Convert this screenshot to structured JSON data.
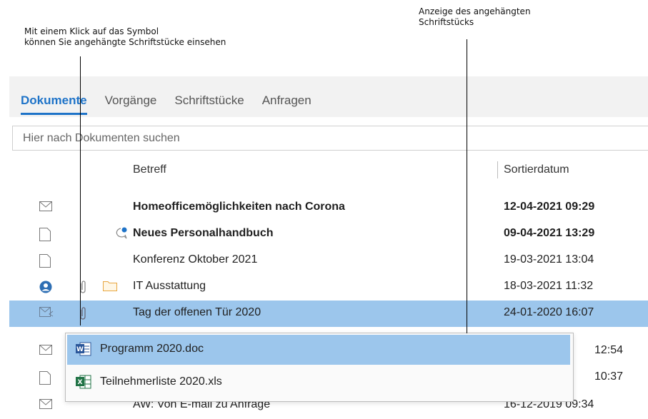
{
  "annotations": {
    "left_text": "Mit einem Klick auf das Symbol\nkönnen Sie angehängte Schriftstücke einsehen",
    "right_text": "Anzeige des angehängten\nSchriftstücks"
  },
  "tabs": [
    "Dokumente",
    "Vorgänge",
    "Schriftstücke",
    "Anfragen"
  ],
  "active_tab": "Dokumente",
  "search": {
    "placeholder": "Hier nach Dokumenten suchen"
  },
  "columns": {
    "subject": "Betreff",
    "date": "Sortierdatum"
  },
  "rows": [
    {
      "type_icon": "envelope-icon",
      "subject": "Homeofficemöglichkeiten nach Corona",
      "date": "12-04-2021 09:29",
      "bold": true
    },
    {
      "type_icon": "document-icon",
      "comment_icon": true,
      "subject": "Neues Personalhandbuch",
      "date": "09-04-2021 13:29",
      "bold": true
    },
    {
      "type_icon": "document-icon",
      "subject": "Konferenz Oktober 2021",
      "date": "19-03-2021 13:04"
    },
    {
      "type_icon": "person-icon",
      "attachment_icon": true,
      "folder_icon": true,
      "subject": "IT Ausstattung",
      "date": "18-03-2021 11:32"
    },
    {
      "type_icon": "envelope-reply-icon",
      "attachment_icon": true,
      "subject": "Tag der offenen Tür 2020",
      "date": "24-01-2020 16:07",
      "selected": true
    },
    {
      "type_icon": "envelope-icon",
      "subject": "",
      "date": "12:54"
    },
    {
      "type_icon": "document-icon",
      "subject": "",
      "date": "10:37"
    },
    {
      "type_icon": "envelope-icon",
      "subject": "AW: Von E-mail zu Anfrage",
      "date": "16-12-2019 09:34"
    }
  ],
  "attachments": [
    {
      "icon": "word-file-icon",
      "name": "Programm 2020.doc",
      "highlighted": true
    },
    {
      "icon": "excel-file-icon",
      "name": "Teilnehmerliste 2020.xls"
    }
  ],
  "colors": {
    "accent": "#1e73c8",
    "selection": "#9cc6ec"
  }
}
